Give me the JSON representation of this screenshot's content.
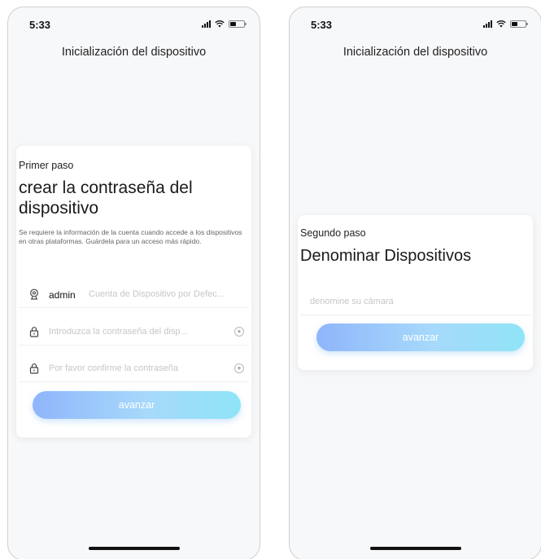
{
  "screens": [
    {
      "status": {
        "time": "5:33"
      },
      "nav_title": "Inicialización del dispositivo",
      "step_label": "Primer paso",
      "step_title": "crear la contraseña del dispositivo",
      "description": "Se requiere la información de la cuenta cuando accede a los dispositivos en otras plataformas. Guárdela para un acceso más rápido.",
      "fields": {
        "username": {
          "icon": "user-icon",
          "value": "admin",
          "placeholder": "Cuenta de Dispositivo por Defec..."
        },
        "password": {
          "icon": "lock-icon",
          "placeholder": "Introduzca la contraseña del disp..."
        },
        "confirm": {
          "icon": "lock-icon",
          "placeholder": "Por favor confirme la contraseña"
        }
      },
      "button_label": "avanzar"
    },
    {
      "status": {
        "time": "5:33"
      },
      "nav_title": "Inicialización del dispositivo",
      "step_label": "Segundo paso",
      "step_title": "Denominar Dispositivos",
      "fields": {
        "name": {
          "placeholder": "denomine su cámara"
        }
      },
      "button_label": "avanzar"
    }
  ],
  "colors": {
    "button_gradient_start": "#8fb5fb",
    "button_gradient_end": "#8fe4f7",
    "placeholder": "#c6c6c6"
  }
}
